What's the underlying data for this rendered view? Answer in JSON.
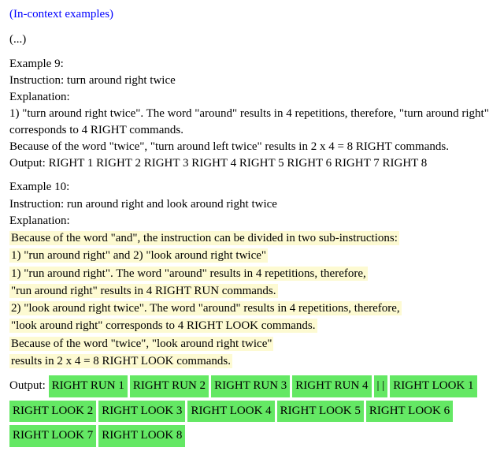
{
  "header": "(In-context examples)",
  "ellipsis": "(...)",
  "ex9": {
    "title": "Example 9:",
    "instr_label": "Instruction:",
    "instr": "turn around right twice",
    "expl_label": "Explanation:",
    "line1": "1) \"turn around right twice\". The word \"around\" results in 4 repetitions, therefore, \"turn around right\" corresponds to 4 RIGHT commands.",
    "line2": "Because of the word \"twice\", \"turn around left twice\" results in 2 x 4 = 8 RIGHT commands.",
    "out_label": "Output:",
    "out": "RIGHT 1 RIGHT 2 RIGHT 3 RIGHT 4 RIGHT 5 RIGHT 6 RIGHT 7 RIGHT 8"
  },
  "ex10": {
    "title": "Example 10:",
    "instr_label": "Instruction:",
    "instr": "run around right and look around right twice",
    "expl_label": "Explanation:",
    "y1": "Because of the word \"and\", the instruction can be divided in two sub-instructions:",
    "y2": "1) \"run around right\" and 2) \"look around right twice\"",
    "y3": "1) \"run around right\". The word \"around\" results in 4 repetitions, therefore,",
    "y4": "\"run around right\" results in 4 RIGHT RUN commands.",
    "y5": "2) \"look around right twice\". The word \"around\" results in 4 repetitions, therefore,",
    "y6": "\"look around right\" corresponds to 4 RIGHT LOOK commands.",
    "y7": "Because of the word \"twice\", \"look around right twice\"",
    "y8": "results in 2 x 4 = 8 RIGHT LOOK commands.",
    "out_label": "Output:",
    "tokens": [
      "RIGHT RUN 1",
      "RIGHT RUN 2",
      "RIGHT RUN 3",
      "RIGHT RUN 4",
      "| |",
      "RIGHT LOOK 1",
      "RIGHT LOOK 2",
      "RIGHT LOOK 3",
      "RIGHT LOOK 4",
      "RIGHT LOOK 5",
      "RIGHT LOOK 6",
      "RIGHT LOOK 7",
      "RIGHT LOOK 8"
    ]
  }
}
